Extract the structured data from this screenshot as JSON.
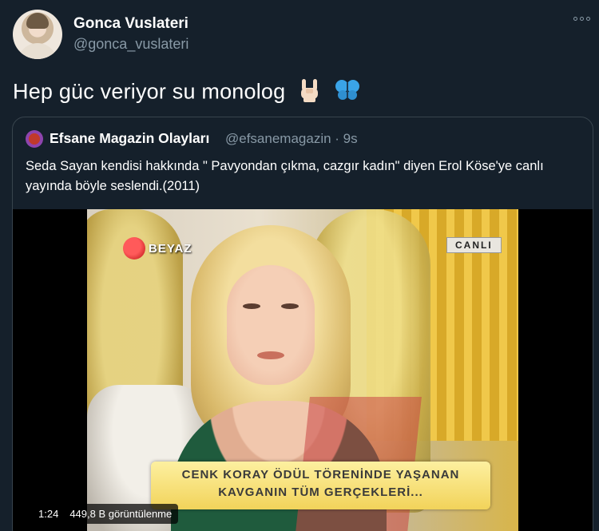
{
  "author": {
    "display_name": "Gonca Vuslateri",
    "handle": "@gonca_vuslateri"
  },
  "tweet": {
    "text": "Hep güc veriyor su monolog",
    "emojis": [
      "rock-on-hand-emoji",
      "butterfly-emoji"
    ]
  },
  "quoted": {
    "display_name": "Efsane Magazin Olayları",
    "handle_time": "@efsanemagazin · 9s",
    "text": "Seda Sayan kendisi hakkında \" Pavyondan çıkma, cazgır kadın\" diyen Erol Köse'ye canlı yayında böyle seslendi.(2011)"
  },
  "video": {
    "channel_logo": "BEYAZ",
    "live_badge": "CANLI",
    "ticker_line1": "CENK KORAY ÖDÜL TÖRENİNDE YAŞANAN",
    "ticker_line2": "KAVGANIN TÜM GERÇEKLERİ...",
    "duration": "1:24",
    "views": "449,8 B görüntülenme"
  },
  "colors": {
    "background": "#15202b",
    "secondary_text": "#8899a6",
    "border": "#38444d"
  }
}
